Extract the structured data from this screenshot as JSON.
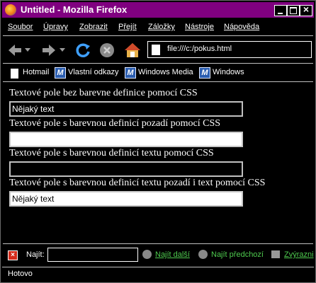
{
  "window": {
    "title": "Untitled - Mozilla Firefox"
  },
  "menu": {
    "items": [
      "Soubor",
      "Úpravy",
      "Zobrazit",
      "Přejít",
      "Záložky",
      "Nástroje",
      "Nápověda"
    ]
  },
  "nav": {
    "url": "file:///c:/pokus.html"
  },
  "bookmarks": {
    "items": [
      "Hotmail",
      "Vlastní odkazy",
      "Windows Media",
      "Windows"
    ]
  },
  "content": {
    "labels": [
      "Textové pole bez barevne definice pomocí CSS",
      "Textové pole s barevnou definicí pozadí pomocí CSS",
      "Textové pole s barevnou definicí textu pomocí CSS",
      "Textové pole s barevnou definicí textu pozadí i text pomocí CSS"
    ],
    "fields": [
      "Nějaký text",
      "",
      "",
      "Nějaký text"
    ]
  },
  "findbar": {
    "label": "Najít:",
    "next": "Najít další",
    "prev": "Najít předchozí",
    "highlight": "Zvýrazni"
  },
  "status": {
    "text": "Hotovo"
  },
  "colors": {
    "titlebar": "#800080",
    "find_links": "#4ecb4e"
  }
}
